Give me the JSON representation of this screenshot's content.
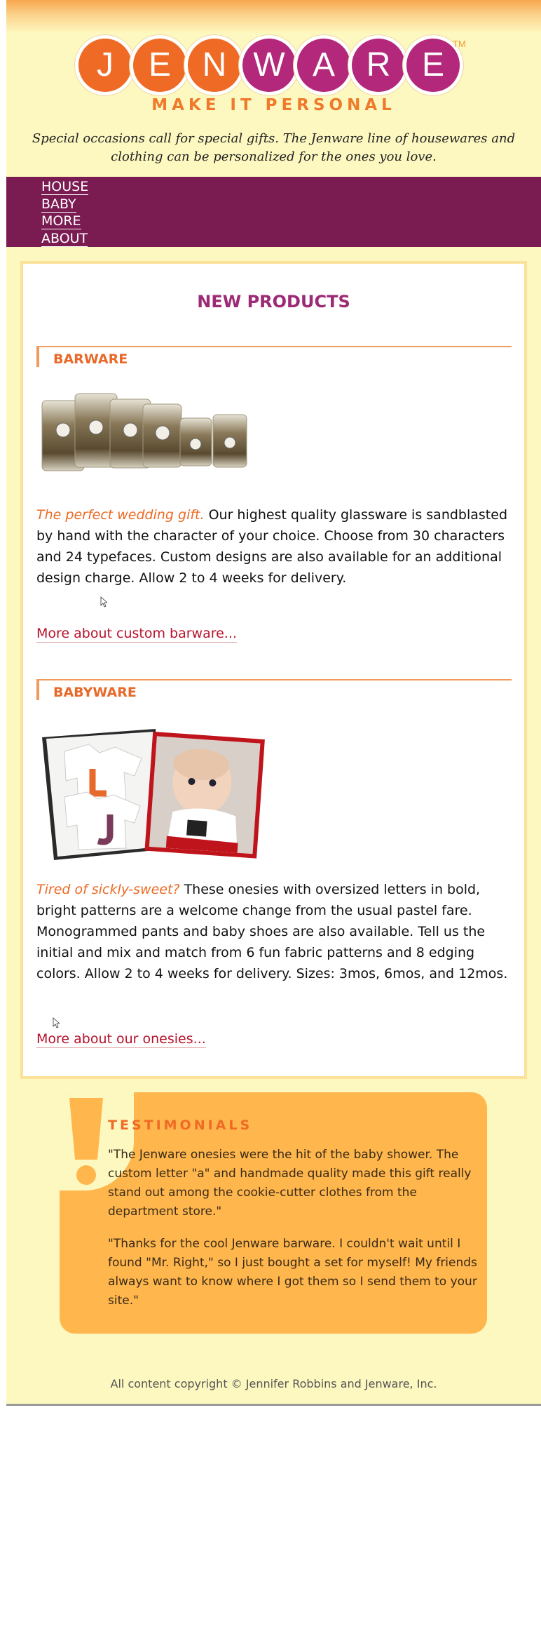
{
  "brand": {
    "letters": [
      "J",
      "E",
      "N",
      "W",
      "A",
      "R",
      "E"
    ],
    "trademark": "TM",
    "tagline": "MAKE IT PERSONAL",
    "intro": "Special occasions call for special gifts. The Jenware line of housewares and clothing can be personalized for the ones you love.",
    "colors": {
      "orange": "#ef6a24",
      "plum": "#b3287b",
      "nav": "#7a1b52",
      "page_bg": "#fdf8c0",
      "callout": "#ffb74d"
    }
  },
  "nav": {
    "items": [
      {
        "label": "HOUSE"
      },
      {
        "label": "BABY"
      },
      {
        "label": "MORE"
      },
      {
        "label": "ABOUT"
      }
    ]
  },
  "products": {
    "title": "NEW PRODUCTS",
    "sections": [
      {
        "heading": "BARWARE",
        "image": "barware-glasses-image",
        "lead": "The perfect wedding gift.",
        "body": " Our highest quality glassware is sandblasted by hand with the character of your choice. Choose from 30 characters and 24 typefaces. Custom designs are also available for an additional design charge. Allow 2 to 4 weeks for delivery.",
        "link": "More about custom barware..."
      },
      {
        "heading": "BABYWARE",
        "image": "baby-onesies-image",
        "lead": "Tired of sickly-sweet?",
        "body": " These onesies with oversized letters in bold, bright patterns are a welcome change from the usual pastel fare. Monogrammed pants and baby shoes are also available. Tell us the initial and mix and match from 6 fun fabric patterns and 8 edging colors. Allow 2 to 4 weeks for delivery. Sizes: 3mos, 6mos, and 12mos.",
        "link": "More about our onesies..."
      }
    ]
  },
  "testimonials": {
    "title": "TESTIMONIALS",
    "icon": "exclamation-icon",
    "quotes": [
      "\"The Jenware onesies were the hit of the baby shower. The custom letter \"a\" and handmade quality made this gift really stand out among the cookie-cutter clothes from the department store.\"",
      "\"Thanks for the cool Jenware barware. I couldn't wait until I found \"Mr. Right,\" so I just bought a set for myself! My friends always want to know where I got them so I send them to your site.\""
    ]
  },
  "footer": {
    "copyright": "All content copyright © Jennifer Robbins and Jenware, Inc."
  }
}
